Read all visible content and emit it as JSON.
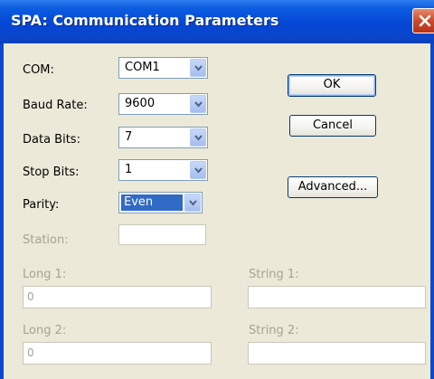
{
  "window": {
    "title": "SPA: Communication Parameters"
  },
  "form": {
    "com": {
      "label": "COM:",
      "value": "COM1"
    },
    "baud_rate": {
      "label": "Baud Rate:",
      "value": "9600"
    },
    "data_bits": {
      "label": "Data Bits:",
      "value": "7"
    },
    "stop_bits": {
      "label": "Stop Bits:",
      "value": "1"
    },
    "parity": {
      "label": "Parity:",
      "value": "Even"
    },
    "station": {
      "label": "Station:",
      "value": ""
    },
    "long1": {
      "label": "Long 1:",
      "value": "0"
    },
    "long2": {
      "label": "Long 2:",
      "value": "0"
    },
    "string1": {
      "label": "String 1:",
      "value": ""
    },
    "string2": {
      "label": "String 2:",
      "value": ""
    }
  },
  "buttons": {
    "ok": "OK",
    "cancel": "Cancel",
    "advanced": "Advanced..."
  },
  "colors": {
    "titlebar": "#0546d6",
    "face": "#ece9d8",
    "selection": "#316ac5",
    "disabled_text": "#a6a390"
  }
}
